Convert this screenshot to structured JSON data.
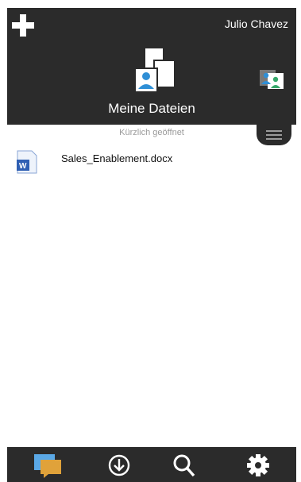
{
  "header": {
    "user_name": "Julio Chavez",
    "title": "Meine Dateien",
    "add_icon": "plus-icon",
    "files_icon": "my-files-icon",
    "switch_icon": "switch-user-icon"
  },
  "content": {
    "section_label": "Kürzlich geöffnet",
    "menu_icon": "hamburger-menu-icon",
    "files": [
      {
        "name": "Sales_Enablement.docx",
        "icon": "word-document-icon"
      }
    ]
  },
  "bottom_bar": {
    "tabs": [
      {
        "icon": "chat-icon"
      },
      {
        "icon": "download-icon"
      },
      {
        "icon": "search-icon"
      },
      {
        "icon": "settings-gear-icon"
      }
    ]
  },
  "colors": {
    "header_bg": "#2b2b2b",
    "accent_blue": "#2f8fd6",
    "text_light": "#ffffff",
    "muted": "#9a9a9a",
    "word_blue": "#2f5fb3",
    "chat_orange": "#e0a23a"
  }
}
